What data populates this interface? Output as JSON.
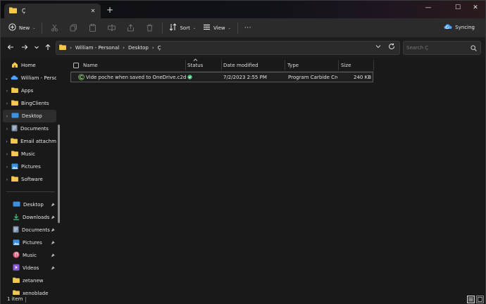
{
  "tab": {
    "title": "Ç",
    "close_glyph": "✕"
  },
  "newtab_glyph": "+",
  "window_controls": {
    "minimize": "—",
    "maximize": "☐",
    "close": "✕"
  },
  "toolbar": {
    "new_label": "New",
    "sort_label": "Sort",
    "view_label": "View",
    "more_glyph": "···",
    "sync_label": "Syncing",
    "chevron": "⌄"
  },
  "address": {
    "crumbs": [
      "William - Personal",
      "Desktop",
      "Ç"
    ],
    "separator": "›"
  },
  "search": {
    "placeholder": "Search Ç"
  },
  "sidebar": {
    "home": "Home",
    "onedrive": "William - Person",
    "folders": [
      "Apps",
      "BingClients",
      "Desktop",
      "Documents",
      "Email attachme",
      "Music",
      "Pictures",
      "Software"
    ],
    "quick_access": [
      "Desktop",
      "Downloads",
      "Documents",
      "Pictures",
      "Music",
      "Videos",
      "zetanew",
      "xenoblade"
    ]
  },
  "columns": {
    "name": "Name",
    "status": "Status",
    "date": "Date modified",
    "type": "Type",
    "size": "Size"
  },
  "files": [
    {
      "name": "Vide poche when saved to OneDrive.c2d",
      "date": "7/2/2023 2:55 PM",
      "type": "Program Carbide Cre...",
      "size": "240 KB"
    }
  ],
  "status_bar": {
    "count": "1 item"
  },
  "colors": {
    "folder": "#f2c94c",
    "accent": "#4aa3ff",
    "synced": "#3ec47a"
  }
}
